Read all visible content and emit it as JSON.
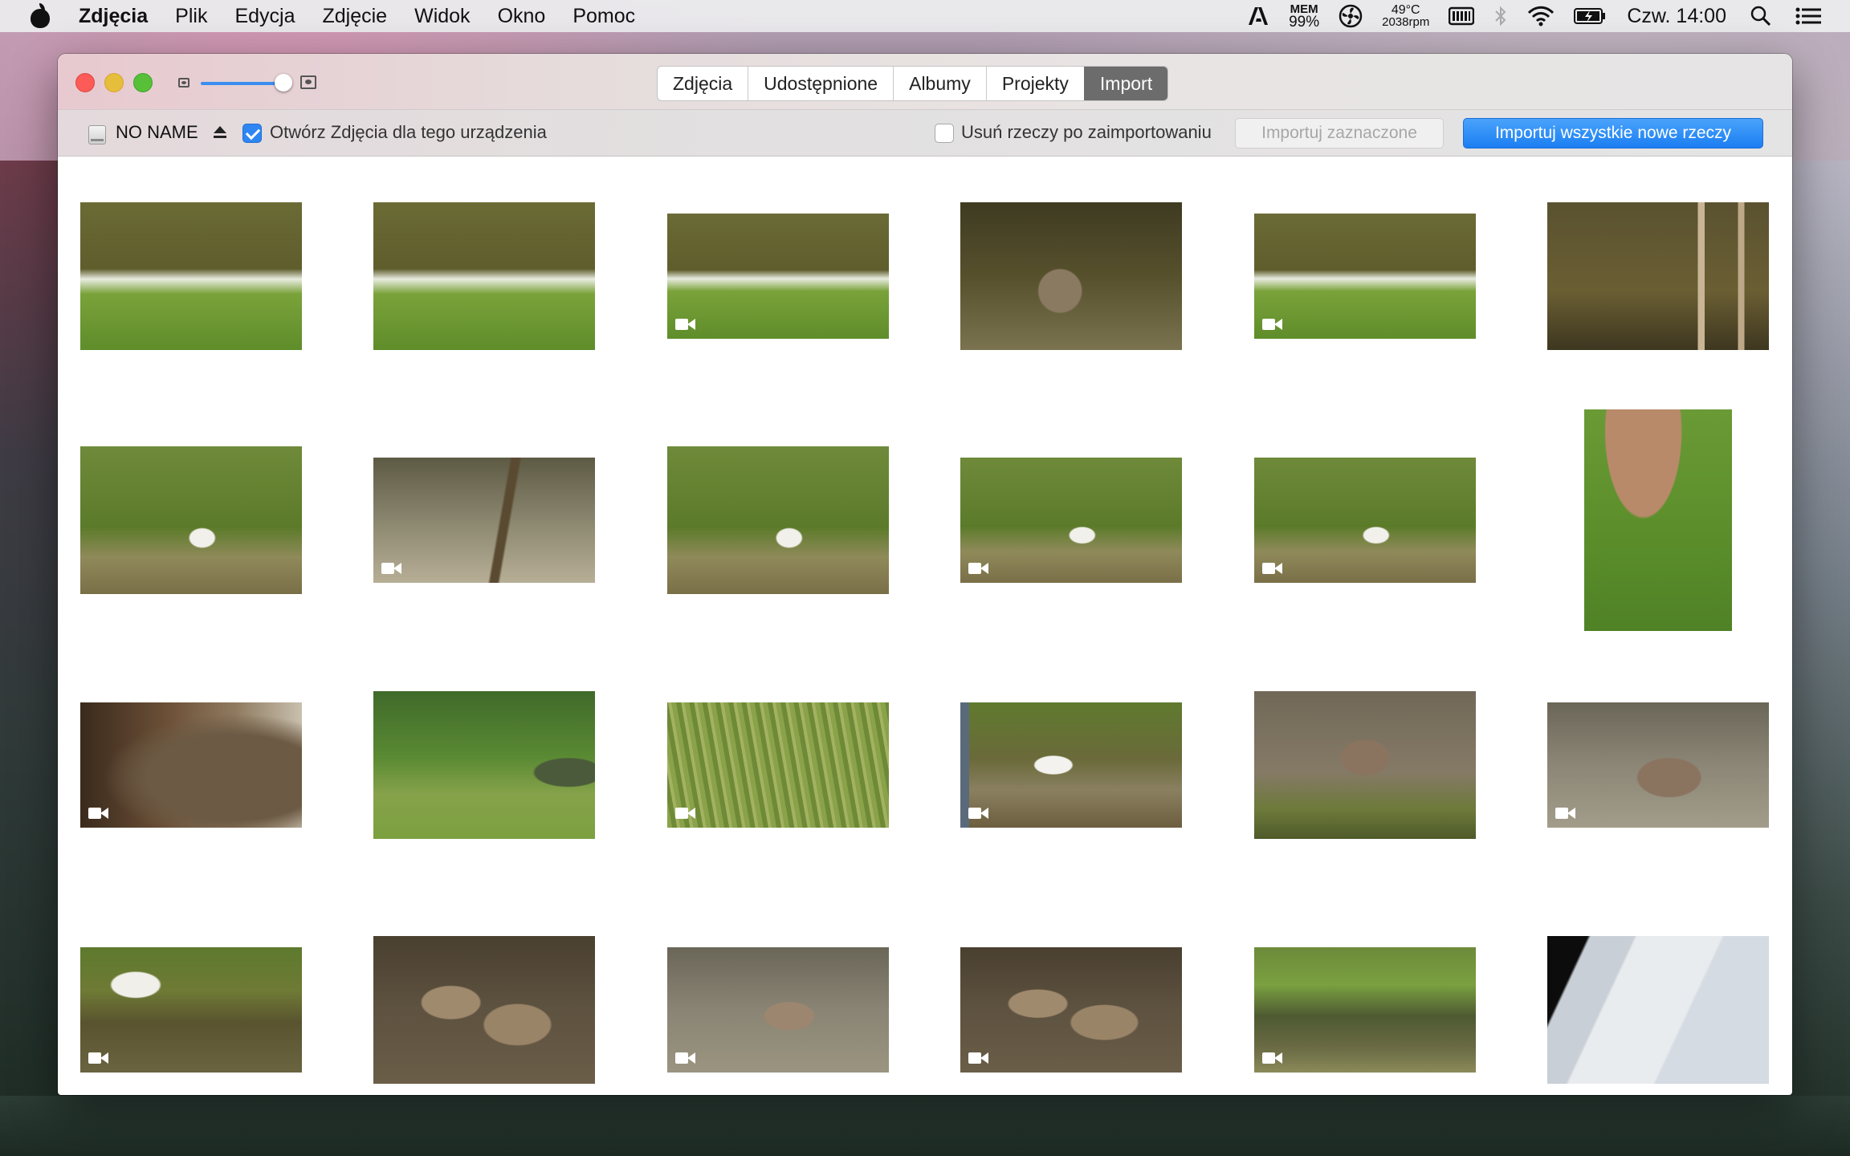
{
  "menubar": {
    "app_name": "Zdjęcia",
    "items": [
      "Plik",
      "Edycja",
      "Zdjęcie",
      "Widok",
      "Okno",
      "Pomoc"
    ],
    "status": {
      "mem_label": "MEM",
      "mem_value": "99%",
      "temperature": "49°C",
      "fan_rpm": "2038rpm",
      "clock": "Czw. 14:00"
    }
  },
  "window": {
    "tabs": [
      {
        "label": "Zdjęcia",
        "active": false
      },
      {
        "label": "Udostępnione",
        "active": false
      },
      {
        "label": "Albumy",
        "active": false
      },
      {
        "label": "Projekty",
        "active": false
      },
      {
        "label": "Import",
        "active": true
      }
    ],
    "toolbar": {
      "device_name": "NO NAME",
      "open_photos_label": "Otwórz Zdjęcia dla tego urządzenia",
      "open_photos_checked": true,
      "delete_after_label": "Usuń rzeczy po zaimportowaniu",
      "delete_after_checked": false,
      "import_selected_label": "Importuj zaznaczone",
      "import_all_label": "Importuj wszystkie nowe rzeczy"
    }
  },
  "thumbnails": [
    {
      "orientation": "landscape",
      "video": false,
      "theme": "swans-grass"
    },
    {
      "orientation": "landscape",
      "video": false,
      "theme": "swans-grass"
    },
    {
      "orientation": "landscape-wide",
      "video": true,
      "theme": "swans-grass"
    },
    {
      "orientation": "landscape",
      "video": false,
      "theme": "cygnet-water"
    },
    {
      "orientation": "landscape-wide",
      "video": true,
      "theme": "swans-grass"
    },
    {
      "orientation": "landscape",
      "video": false,
      "theme": "pond-posts"
    },
    {
      "orientation": "landscape",
      "video": false,
      "theme": "woman-swan"
    },
    {
      "orientation": "landscape-wide",
      "video": true,
      "theme": "water-post"
    },
    {
      "orientation": "landscape",
      "video": false,
      "theme": "woman-swan"
    },
    {
      "orientation": "landscape-wide",
      "video": true,
      "theme": "woman-swan"
    },
    {
      "orientation": "landscape-wide",
      "video": true,
      "theme": "woman-swan"
    },
    {
      "orientation": "portrait",
      "video": false,
      "theme": "feet-grass"
    },
    {
      "orientation": "landscape-wide",
      "video": true,
      "theme": "blur-brown"
    },
    {
      "orientation": "landscape",
      "video": false,
      "theme": "man-woman-swan"
    },
    {
      "orientation": "landscape-wide",
      "video": true,
      "theme": "reeds"
    },
    {
      "orientation": "landscape-wide",
      "video": true,
      "theme": "swan-shore"
    },
    {
      "orientation": "landscape",
      "video": false,
      "theme": "cygnets-shore"
    },
    {
      "orientation": "landscape-wide",
      "video": true,
      "theme": "cygnet-grey-water"
    },
    {
      "orientation": "landscape-wide",
      "video": true,
      "theme": "swans-reeds-water"
    },
    {
      "orientation": "landscape",
      "video": false,
      "theme": "cygnets-brown"
    },
    {
      "orientation": "landscape-wide",
      "video": true,
      "theme": "cygnets-grey"
    },
    {
      "orientation": "landscape-wide",
      "video": true,
      "theme": "cygnets-brown"
    },
    {
      "orientation": "landscape-wide",
      "video": true,
      "theme": "pond-reeds"
    },
    {
      "orientation": "landscape",
      "video": false,
      "theme": "screen-photo"
    }
  ],
  "colors": {
    "accent": "#2f86f2",
    "active_tab": "#6c6c6c"
  }
}
